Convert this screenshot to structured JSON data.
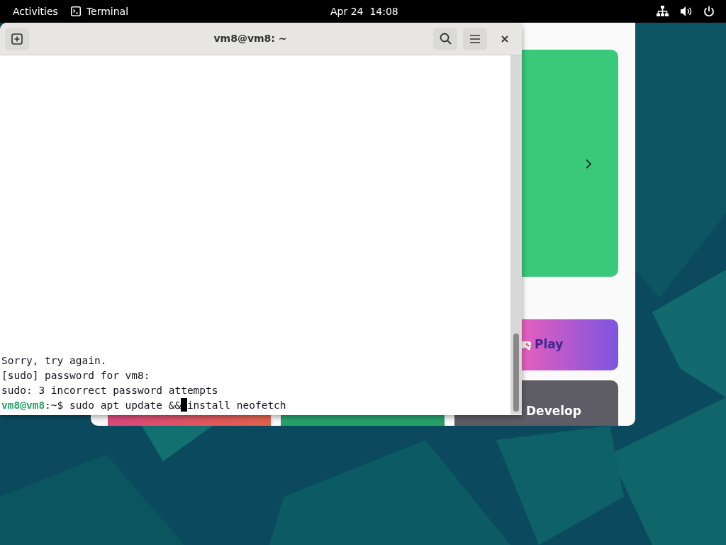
{
  "top_bar": {
    "activities": "Activities",
    "app_name": "Terminal",
    "date": "Apr 24",
    "time": "14:08"
  },
  "background_window": {
    "cards": [
      {
        "label": "Play"
      },
      {
        "label": "Develop"
      }
    ]
  },
  "terminal": {
    "title": "vm8@vm8: ~",
    "lines": [
      "Sorry, try again.",
      "[sudo] password for vm8:",
      "sudo: 3 incorrect password attempts"
    ],
    "prompt": {
      "user_host": "vm8@vm8",
      "path": ":~$ ",
      "before_cursor": "sudo apt update &&",
      "after_cursor": "install neofetch"
    }
  }
}
